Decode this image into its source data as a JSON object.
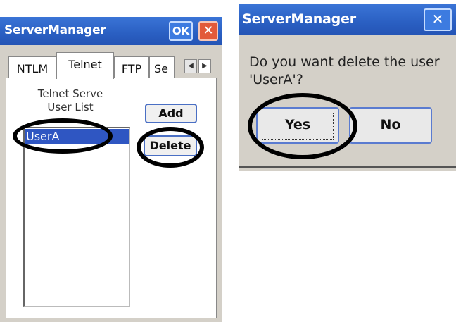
{
  "window": {
    "title": "ServerManager",
    "ok_label": "OK",
    "close_symbol": "✕"
  },
  "tabs": [
    {
      "label": "NTLM"
    },
    {
      "label": "Telnet"
    },
    {
      "label": "FTP"
    },
    {
      "label": "Se"
    }
  ],
  "tab_scroll": {
    "left_icon": "◀",
    "right_icon": "▶"
  },
  "telnet": {
    "list_title_line1": "Telnet Serve",
    "list_title_line2": "User List",
    "users": [
      "UserA"
    ],
    "add_label": "Add",
    "delete_label": "Delete"
  },
  "dialog": {
    "title": "ServerManager",
    "close_symbol": "✕",
    "message": "Do you want delete the user 'UserA'?",
    "yes_first": "Y",
    "yes_rest": "es",
    "no_first": "N",
    "no_rest": "o"
  },
  "colors": {
    "titlebar": "#2a5fc2",
    "selection": "#2f56c2",
    "close_button": "#e25a3a",
    "annotation_circle": "#000000"
  }
}
